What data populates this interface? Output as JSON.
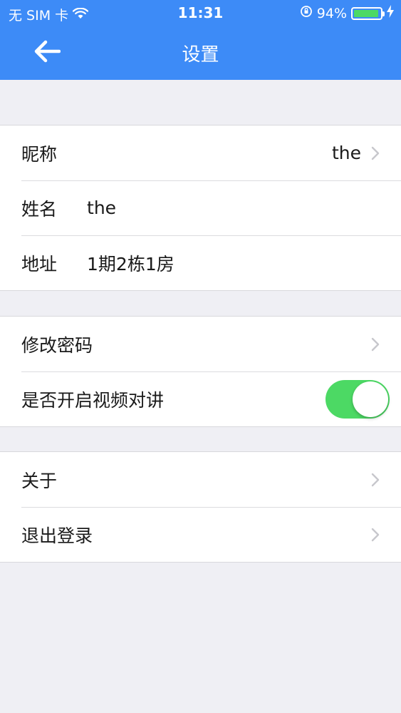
{
  "status_bar": {
    "carrier": "无 SIM 卡",
    "time": "11:31",
    "battery_percent": "94%",
    "battery_level": 0.94,
    "icons": [
      "wifi-icon",
      "rotation-lock-icon",
      "battery-icon",
      "charging-icon"
    ]
  },
  "nav": {
    "title": "设置",
    "back_icon": "back-arrow-icon"
  },
  "profile": {
    "nickname_label": "昵称",
    "nickname_value": "the",
    "name_label": "姓名",
    "name_value": "the",
    "address_label": "地址",
    "address_value": "1期2栋1房"
  },
  "security": {
    "change_password_label": "修改密码",
    "video_intercom_label": "是否开启视频对讲",
    "video_intercom_enabled": true
  },
  "misc": {
    "about_label": "关于",
    "logout_label": "退出登录"
  },
  "colors": {
    "nav_bar": "#3d8bf7",
    "background": "#efeff4",
    "toggle_on": "#4cd964",
    "chevron": "#c7c7cc"
  }
}
